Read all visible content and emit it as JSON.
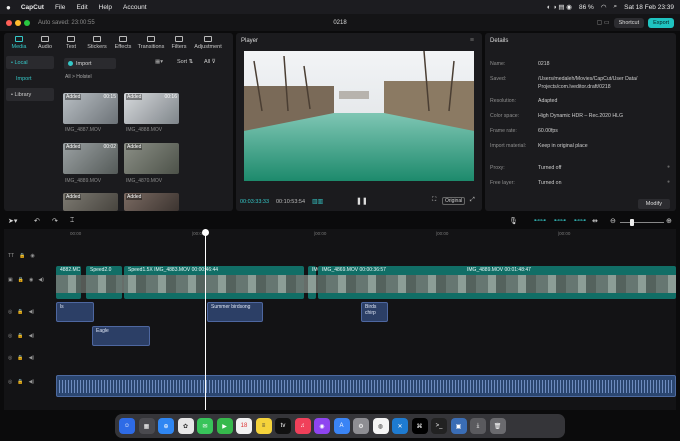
{
  "menubar": {
    "app": "CapCut",
    "items": [
      "File",
      "Edit",
      "Help",
      "Account"
    ],
    "battery": "86 %",
    "datetime": "Sat 18 Feb  23:39"
  },
  "titlebar": {
    "autosave": "Auto saved: 23:00:55",
    "project": "0218",
    "shortcut": "Shortcut",
    "export": "Export"
  },
  "tabs": [
    "Media",
    "Audio",
    "Text",
    "Stickers",
    "Effects",
    "Transitions",
    "Filters",
    "Adjustment"
  ],
  "sidebar": {
    "local": "• Local",
    "import": "Import",
    "library": "• Library"
  },
  "media": {
    "import_btn": "Import",
    "sort": "Sort",
    "all": "All",
    "folder": "Holstel",
    "items": [
      {
        "label": "Added",
        "duration": "00:15",
        "name": "IMG_4887.MOV"
      },
      {
        "label": "Added",
        "duration": "00:16",
        "name": "IMG_4888.MOV"
      },
      {
        "label": "Added",
        "duration": "00:02",
        "name": "IMG_4889.MOV"
      },
      {
        "label": "Added",
        "duration": "",
        "name": "IMG_4870.MOV"
      },
      {
        "label": "Added",
        "duration": "",
        "name": ""
      },
      {
        "label": "Added",
        "duration": "",
        "name": ""
      }
    ]
  },
  "player": {
    "title": "Player",
    "current": "00:03:33:33",
    "total": "00:10:53:54",
    "ratio": "Original"
  },
  "details": {
    "title": "Details",
    "rows": [
      {
        "k": "Name:",
        "v": "0218"
      },
      {
        "k": "Saved:",
        "v": "/Users/medaleh/Movies/CapCut/User Data/"
      },
      {
        "k": "",
        "v": "Projects/com.lveditor.draft/0218"
      },
      {
        "k": "Resolution:",
        "v": "Adapted"
      },
      {
        "k": "Color space:",
        "v": "High Dynamic HDR – Rec.2020 HLG"
      },
      {
        "k": "Frame rate:",
        "v": "60.00fps"
      },
      {
        "k": "Import material:",
        "v": "Keep in original place"
      },
      {
        "k": "Proxy:",
        "v": "Turned off"
      },
      {
        "k": "Free layer:",
        "v": "Turned on"
      }
    ],
    "modify": "Modify"
  },
  "timeline": {
    "ruler": [
      "00:00",
      "|00:00",
      "|00:00",
      "|00:00",
      "|00:00"
    ],
    "video_clips": [
      {
        "t": "4882.MC"
      },
      {
        "t": "Speed2.0"
      },
      {
        "t": "Speed1.5X  IMG_4883.MOV  00:00:46:44"
      },
      {
        "t": "IMG"
      },
      {
        "t": "IMG_4869.MOV  00:00:36:57"
      },
      {
        "t": "IMG_4889.MOV  00:01:48:47"
      }
    ],
    "audio_clips": [
      {
        "t": "ls"
      },
      {
        "t": "Summer birdsong"
      },
      {
        "t": "Birds chirp"
      },
      {
        "t": "Eagle"
      }
    ]
  },
  "colors": {
    "accent": "#1fc3c0",
    "audio": "#2c3f66",
    "video": "#116e66"
  }
}
